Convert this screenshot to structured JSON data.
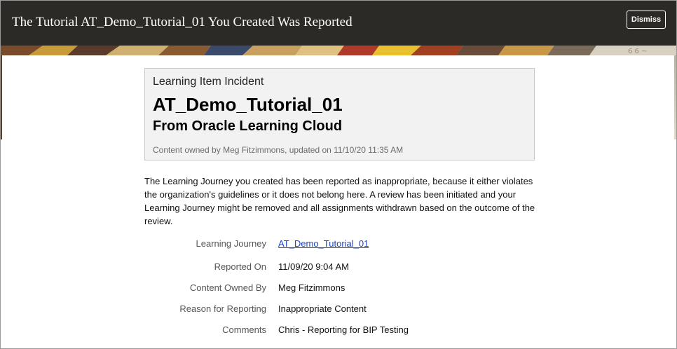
{
  "header": {
    "title": "The Tutorial AT_Demo_Tutorial_01 You Created Was Reported",
    "dismiss_label": "Dismiss",
    "background": "#2b2a26"
  },
  "card": {
    "eyebrow": "Learning Item Incident",
    "title": "AT_Demo_Tutorial_01",
    "subtitle": "From Oracle Learning Cloud",
    "meta": "Content owned by Meg Fitzimmons, updated on 11/10/20 11:35 AM"
  },
  "message": "The Learning Journey you created has been reported as inappropriate, because it either violates the organization's guidelines or it does not belong here. A review has been initiated and your Learning Journey might be removed and all assignments withdrawn based on the outcome of the review.",
  "details": [
    {
      "label": "Learning Journey",
      "value": "AT_Demo_Tutorial_01"
    },
    {
      "label": "Reported On",
      "value": "11/09/20 9:04 AM"
    },
    {
      "label": "Content Owned By",
      "value": "Meg Fitzimmons"
    },
    {
      "label": "Reason for Reporting",
      "value": "Inappropriate Content"
    },
    {
      "label": "Comments",
      "value": "Chris - Reporting for BIP Testing"
    }
  ],
  "colors": {
    "link": "#1a44c8",
    "label": "#555555"
  }
}
